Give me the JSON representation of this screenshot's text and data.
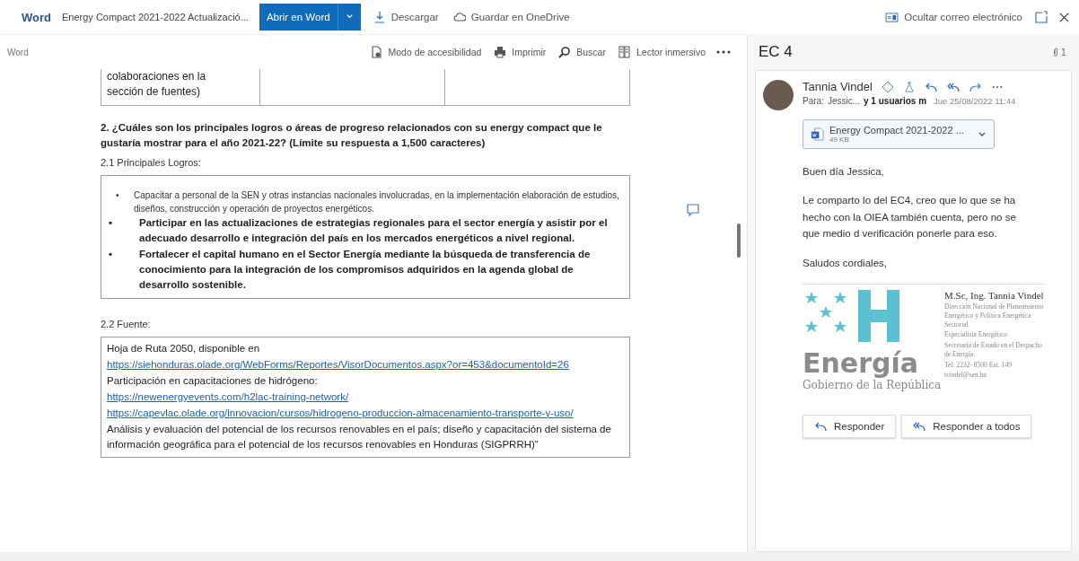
{
  "top_bar": {
    "app_name": "Word",
    "doc_title": "Energy Compact 2021-2022 Actualizació...",
    "open_button": "Abrir en Word",
    "actions": [
      {
        "label": "Descargar",
        "kind": "download"
      },
      {
        "label": "Guardar en OneDrive",
        "kind": "cloud"
      }
    ],
    "hide_email": "Ocultar correo electrónico"
  },
  "doc_toolbar": {
    "label": "Word",
    "actions": [
      {
        "label": "Modo de accesibilidad",
        "kind": "accessibility"
      },
      {
        "label": "Imprimir",
        "kind": "print"
      },
      {
        "label": "Buscar",
        "kind": "search"
      },
      {
        "label": "Lector inmersivo",
        "kind": "reader"
      }
    ]
  },
  "document": {
    "table_fragment": [
      "colaboraciones en la",
      "sección de fuentes)"
    ],
    "question": "2. ¿Cuáles son los principales logros o áreas de progreso relacionados con su energy compact que le gustaría mostrar para el año 2021-22? (Límite su respuesta a 1,500 caracteres)",
    "achievements_heading": "2.1 Principales Logros:",
    "achievements": [
      {
        "kind": "normal",
        "bullet": "•",
        "text": "Capacitar a personal de la SEN y otras instancias nacionales involucradas, en la implementación elaboración de estudios, diseños, construcción y operación de proyectos energéticos."
      },
      {
        "kind": "bold",
        "bullet": "•",
        "text": "Participar en las actualizaciones de estrategias regionales para el sector energía y asistir por el adecuado desarrollo e integración del país en los mercados energéticos a nivel regional."
      },
      {
        "kind": "bold",
        "bullet": "•",
        "text": "Fortalecer el capital humano en el Sector Energía mediante la búsqueda de transferencia de conocimiento para la integración de los compromisos adquiridos en la agenda global de desarrollo sostenible."
      }
    ],
    "sources_heading": "2.2 Fuente:",
    "sources": [
      {
        "kind": "text",
        "text": "Hoja de Ruta 2050, disponible en"
      },
      {
        "kind": "link",
        "text": "https://siehonduras.olade.org/WebForms/Reportes/VisorDocumentos.aspx?or=453&documentoId=26"
      },
      {
        "kind": "text",
        "text": "Participación en capacitaciones de hidrógeno:"
      },
      {
        "kind": "link",
        "text": "https://newenergyevents.com/h2lac-training-network/"
      },
      {
        "kind": "link",
        "text": "https://capevlac.olade.org/innovacion/cursos/hidrogeno-produccion-almacenamiento-transporte-y-uso/"
      },
      {
        "kind": "text",
        "text": "Análisis y evaluación del potencial de los recursos renovables en el país; diseño y capacitación del sistema de información geográfica para el potencial de los recursos renovables en Honduras (SIGPRRH)”"
      }
    ]
  },
  "email": {
    "subject": "EC 4",
    "attachment_count": "1",
    "sender": "Tannia Vindel",
    "to_label": "Para:",
    "to": "Jessic...",
    "to_more": "y 1 usuarios m",
    "date": "Jue 25/08/2022 11:44",
    "attachment": {
      "name": "Energy Compact 2021-2022 ...",
      "size": "49 KB"
    },
    "body": [
      "Buen día Jessica,",
      "Le comparto lo del EC4, creo que lo que se ha hecho con la OIEA también cuenta, pero no se que medio d verificación ponerle para eso.",
      "Saludos cordiales,"
    ],
    "signature": {
      "logo_word": "Energía",
      "logo_sub": "Gobierno de la República",
      "name": "M.Sc, Ing. Tannia Vindel",
      "lines": [
        "Dirección Nacional de Planeamiento Energético y Política Energética Sectorial",
        "Especialista Energético",
        "Secretaría de Estado en el Despacho de Energía",
        "Tel: 2232- 8500 Ext. 149",
        "tvindel@sen.hn"
      ]
    },
    "replies": [
      {
        "label": "Responder",
        "kind": "reply"
      },
      {
        "label": "Responder a todos",
        "kind": "reply_all"
      }
    ]
  }
}
